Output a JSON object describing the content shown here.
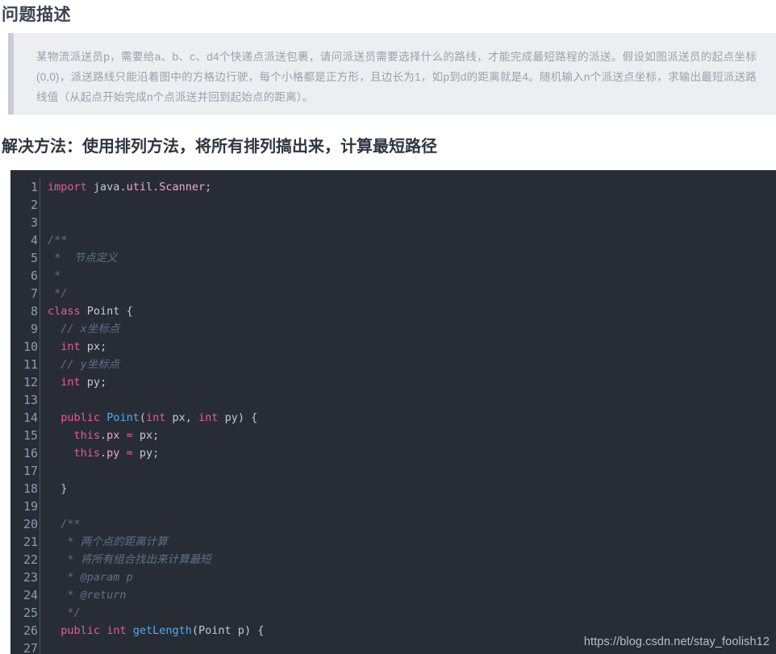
{
  "headings": {
    "problem_title": "问题描述",
    "solution_title": "解决方法：使用排列方法，将所有排列搞出来，计算最短路径"
  },
  "description": {
    "text": "某物流派送员p，需要给a、b、c、d4个快递点派送包裹，请问派送员需要选择什么的路线，才能完成最短路程的派送。假设如图派送员的起点坐标(0,0)，派送路线只能沿着图中的方格边行驶，每个小格都是正方形，且边长为1，如p到d的距离就是4。随机输入n个派送点坐标，求输出最短派送路线值（从起点开始完成n个点派送并回到起始点的距离）。"
  },
  "code": {
    "language": "java",
    "line_numbers": [
      "1",
      "2",
      "3",
      "4",
      "5",
      "6",
      "7",
      "8",
      "9",
      "10",
      "11",
      "12",
      "13",
      "14",
      "15",
      "16",
      "17",
      "18",
      "19",
      "20",
      "21",
      "22",
      "23",
      "24",
      "25",
      "26",
      "27"
    ],
    "lines": [
      "import java.util.Scanner;",
      "",
      "",
      "/**",
      " *  节点定义",
      " *",
      " */",
      "class Point {",
      "  // x坐标点",
      "  int px;",
      "  // y坐标点",
      "  int py;",
      "",
      "  public Point(int px, int py) {",
      "    this.px = px;",
      "    this.py = py;",
      "",
      "  }",
      "",
      "  /**",
      "   * 两个点的距离计算",
      "   * 将所有组合找出来计算最短",
      "   * @param p",
      "   * @return",
      "   */",
      "  public int getLength(Point p) {",
      ""
    ]
  },
  "watermark": {
    "url": "https://blog.csdn.net/stay_foolish12"
  },
  "colors": {
    "code_background": "#282c35",
    "description_background": "#eceef1",
    "description_accent": "#c8ccd4",
    "keyword": "#e45d9c",
    "class_name": "#52adf2",
    "comment": "#62708a",
    "plain_text": "#c2c9d6",
    "line_number": "#8d9bb0",
    "heading": "#3b4351"
  }
}
